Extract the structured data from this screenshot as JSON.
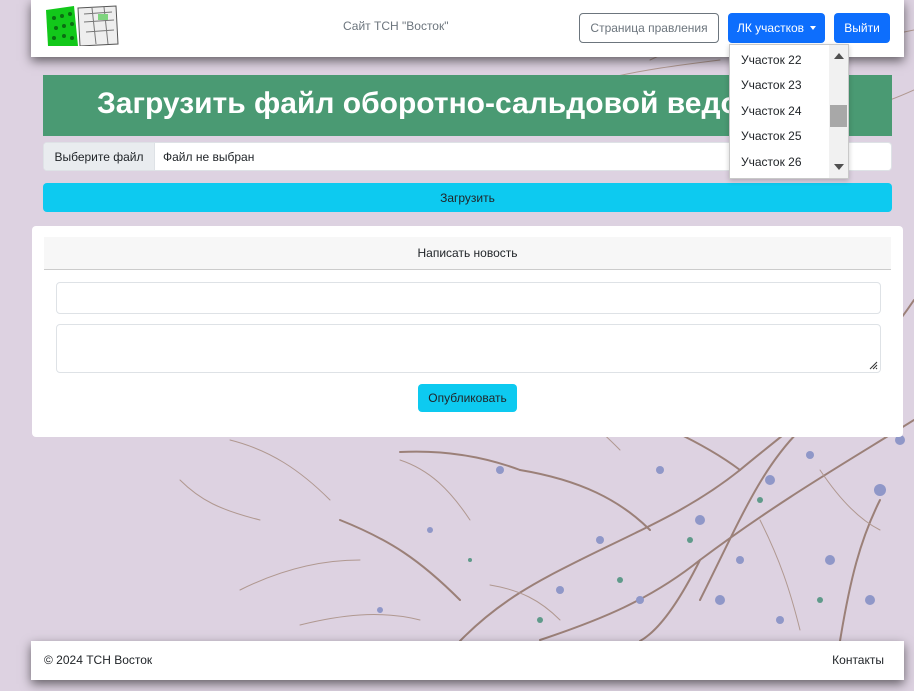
{
  "header": {
    "site_title": "Сайт ТСН \"Восток\"",
    "board_page_label": "Страница правления",
    "lk_label": "ЛК участков",
    "logout_label": "Выйти"
  },
  "upload": {
    "title": "Загрузить файл оборотно-сальдовой ведомости",
    "file_button_label": "Выберите файл",
    "file_status": "Файл не выбран",
    "submit_label": "Загрузить"
  },
  "news": {
    "header": "Написать новость",
    "title_value": "",
    "text_value": "",
    "publish_label": "Опубликовать"
  },
  "dropdown": {
    "items": [
      {
        "label": "Участок 22"
      },
      {
        "label": "Участок 23"
      },
      {
        "label": "Участок 24"
      },
      {
        "label": "Участок 25"
      },
      {
        "label": "Участок 26"
      }
    ],
    "scroll_position": 0.45
  },
  "footer": {
    "copyright": "© 2024 ТСН Восток",
    "contacts_label": "Контакты"
  },
  "colors": {
    "primary": "#0d6efd",
    "info": "#0dcaf0",
    "title_band": "#4a9a73",
    "background": "#ddd2e1"
  },
  "icons": [
    "logo-image",
    "caret-down-icon",
    "scroll-up-icon",
    "scroll-down-icon",
    "resize-handle-icon"
  ]
}
